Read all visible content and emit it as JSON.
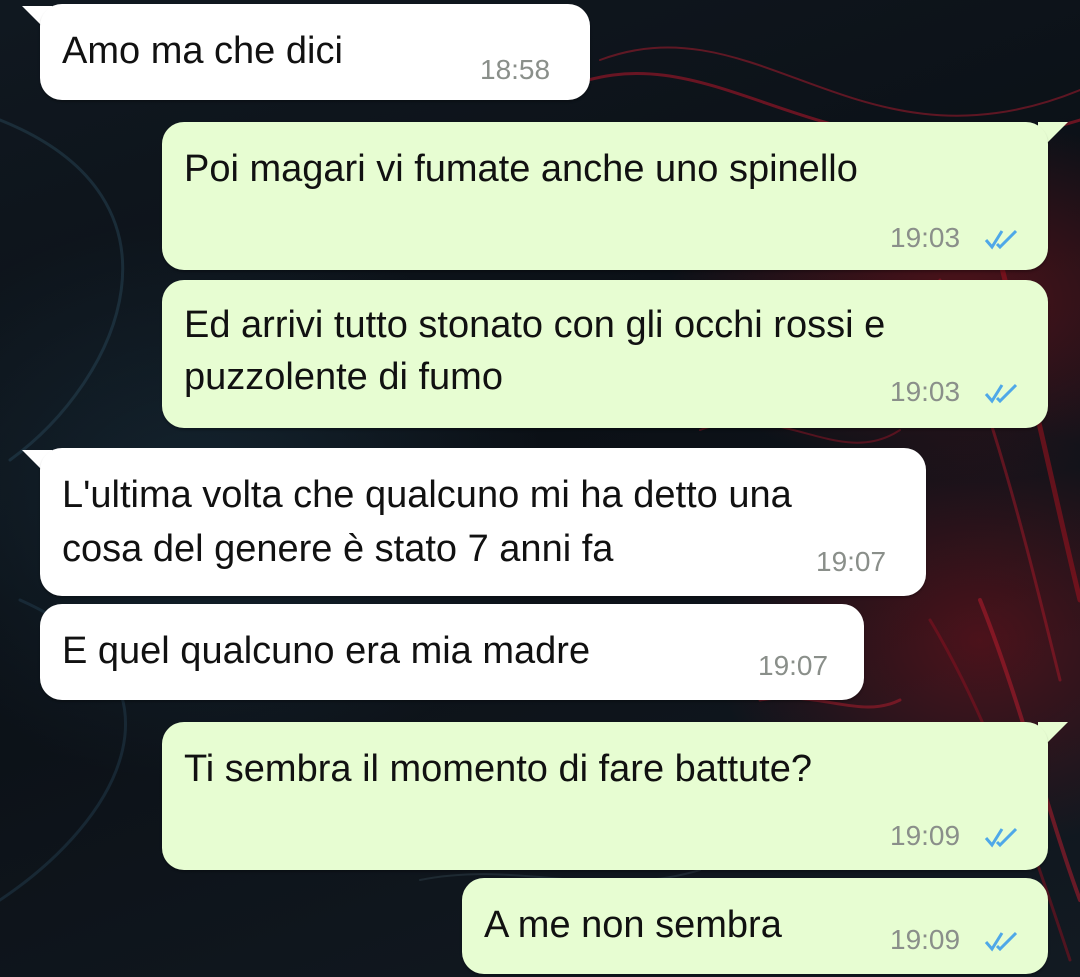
{
  "colors": {
    "incoming_bubble": "#ffffff",
    "outgoing_bubble": "#e7fdd2",
    "read_ticks": "#4fa8e8",
    "timestamp": "#8a8f8a"
  },
  "messages": [
    {
      "direction": "incoming",
      "lines": [
        "Amo ma che dici"
      ],
      "time": "18:58"
    },
    {
      "direction": "outgoing",
      "lines": [
        "Poi magari vi fumate anche uno spinello"
      ],
      "time": "19:03",
      "status": "read"
    },
    {
      "direction": "outgoing",
      "lines": [
        "Ed arrivi tutto stonato con gli occhi rossi e",
        "puzzolente di fumo"
      ],
      "time": "19:03",
      "status": "read"
    },
    {
      "direction": "incoming",
      "lines": [
        "L'ultima volta che qualcuno mi ha detto una",
        "cosa del genere è stato 7 anni fa"
      ],
      "time": "19:07"
    },
    {
      "direction": "incoming",
      "lines": [
        "E quel qualcuno era mia madre"
      ],
      "time": "19:07"
    },
    {
      "direction": "outgoing",
      "lines": [
        "Ti sembra il momento di fare battute?"
      ],
      "time": "19:09",
      "status": "read"
    },
    {
      "direction": "outgoing",
      "lines": [
        "A me non sembra"
      ],
      "time": "19:09",
      "status": "read"
    }
  ],
  "icons": {
    "read_status": "double-check-icon"
  }
}
